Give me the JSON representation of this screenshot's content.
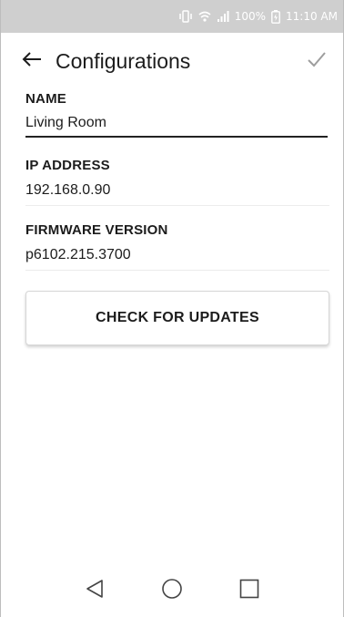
{
  "status_bar": {
    "battery_percent": "100%",
    "time": "11:10 AM",
    "icons": [
      "vibrate-icon",
      "wifi-icon",
      "signal-icon",
      "battery-icon"
    ]
  },
  "header": {
    "title": "Configurations",
    "back_icon": "arrow-left-icon",
    "confirm_icon": "check-icon"
  },
  "fields": {
    "name_label": "NAME",
    "name_value": "Living Room",
    "ip_label": "IP ADDRESS",
    "ip_value": "192.168.0.90",
    "firmware_label": "FIRMWARE VERSION",
    "firmware_value": "p6102.215.3700"
  },
  "actions": {
    "check_updates_label": "CHECK FOR UPDATES"
  },
  "nav_bar": {
    "icons": [
      "back-triangle-icon",
      "home-circle-icon",
      "recents-square-icon"
    ]
  },
  "colors": {
    "status_bar_bg": "#cfcfcf",
    "text": "#1c1c1c",
    "input_underline": "#222222"
  }
}
